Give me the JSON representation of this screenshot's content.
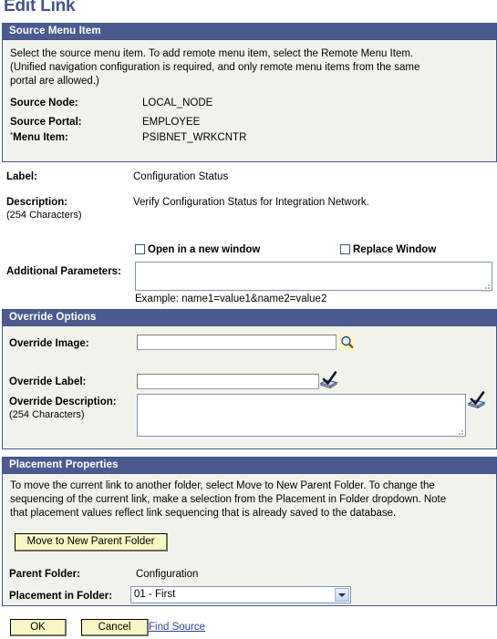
{
  "page": {
    "title": "Edit Link",
    "accent_header_bg": "#4B5B8F",
    "panel_bg": "#F2F2EC",
    "button_bg": "#F7F6C4",
    "link_color": "#2B3FA0"
  },
  "source_menu_item": {
    "header": "Source Menu Item",
    "description_line1": "Select the source menu item. To add remote menu item, select the Remote Menu Item.",
    "description_line2": "(Unified navigation configuration is required, and only remote menu items from the same",
    "description_line3": "portal are allowed.)",
    "fields": [
      {
        "label": "Source Node:",
        "value": "LOCAL_NODE",
        "required": false
      },
      {
        "label": "Source Portal:",
        "value": "EMPLOYEE",
        "required": false
      },
      {
        "label": "Menu Item:",
        "value": "PSIBNET_WRKCNTR",
        "required": true
      }
    ]
  },
  "link_details": {
    "label_label": "Label:",
    "label_value": "Configuration Status",
    "description_label": "Description:",
    "description_hint": "(254 Characters)",
    "description_value": "Verify Configuration Status for Integration Network.",
    "open_new_window_label": "Open in a new window",
    "open_new_window_checked": false,
    "replace_window_label": "Replace Window",
    "replace_window_checked": false,
    "additional_parameters_label": "Additional Parameters:",
    "additional_parameters_value": "",
    "additional_parameters_example": "Example: name1=value1&name2=value2"
  },
  "override_options": {
    "header": "Override Options",
    "image_label": "Override Image:",
    "image_value": "",
    "lookup_icon": "magnifier-icon",
    "label_label": "Override Label:",
    "label_value": "",
    "label_spellcheck_icon": "spellcheck-icon",
    "description_label": "Override Description:",
    "description_hint": "(254 Characters)",
    "description_value": "",
    "description_spellcheck_icon": "spellcheck-icon"
  },
  "placement_properties": {
    "header": "Placement Properties",
    "description_line1": "To move the current link to another folder, select Move to New Parent Folder. To change the",
    "description_line2": "sequencing of the current link, make a selection from the Placement in Folder dropdown. Note",
    "description_line3": "that placement values reflect link sequencing that is already saved to the database.",
    "move_button": "Move to New Parent Folder",
    "parent_folder_label": "Parent Folder:",
    "parent_folder_value": "Configuration",
    "placement_label": "Placement in Folder:",
    "placement_selected": "01 - First",
    "placement_options": [
      "01 - First"
    ]
  },
  "footer": {
    "ok_label": "OK",
    "cancel_label": "Cancel",
    "find_source_label": "Find Source"
  }
}
